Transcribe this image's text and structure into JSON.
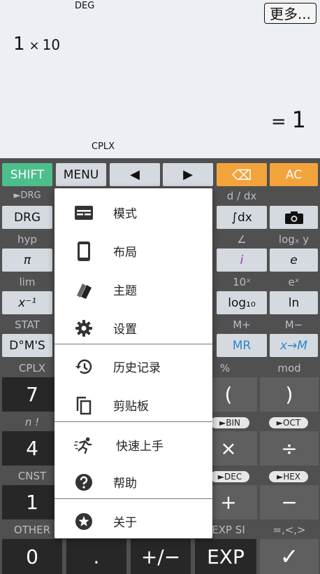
{
  "display": {
    "angle_mode": "DEG",
    "more_button": "更多...",
    "expr_mantissa": "1",
    "expr_times": "×",
    "expr_base": "10",
    "result_eq": "=",
    "result_value": "1",
    "complex_mode": "CPLX"
  },
  "top_row": {
    "shift": "SHIFT",
    "menu": "MENU",
    "left_arrow": "◀",
    "right_arrow": "▶",
    "backspace": "⌫",
    "ac": "AC"
  },
  "labels": {
    "to_drg": "►DRG",
    "ddx": "d / dx",
    "hyp": "hyp",
    "angle": "∠",
    "logxy": "logₓ y",
    "lim": "lim",
    "tenx": "10ˣ",
    "ex": "eˣ",
    "stat": "STAT",
    "mplus": "M+",
    "mminus": "M−",
    "cplx": "CPLX",
    "percent": "%",
    "mod": "mod",
    "nfact": "n !",
    "cnst": "CNST",
    "other": "OTHER",
    "expsi": "EXP SI",
    "relations": "=,<,>"
  },
  "pills": {
    "bin": "►BIN",
    "oct": "►OCT",
    "dec": "►DEC",
    "hex": "►HEX"
  },
  "keys": {
    "drg": "DRG",
    "integral": "∫dx",
    "pi": "π",
    "i": "i",
    "e": "e",
    "xinv": "x⁻¹",
    "log10": "log₁₀",
    "ln": "ln",
    "dms": "D°M'S",
    "mr": "MR",
    "xtom": "x→M",
    "seven": "7",
    "open_paren": "(",
    "close_paren": ")",
    "four": "4",
    "times": "×",
    "divide": "÷",
    "one": "1",
    "plus": "+",
    "minus": "−",
    "zero": "0",
    "dot": ".",
    "plusminus": "+/−",
    "exp": "EXP",
    "enter": "✓"
  },
  "menu": {
    "items": [
      {
        "label": "模式",
        "icon": "mode-icon"
      },
      {
        "label": "布局",
        "icon": "layout-icon"
      },
      {
        "label": "主题",
        "icon": "theme-icon"
      },
      {
        "label": "设置",
        "icon": "gear-icon"
      },
      {
        "label": "历史记录",
        "icon": "history-icon"
      },
      {
        "label": "剪贴板",
        "icon": "clipboard-icon"
      },
      {
        "label": "快速上手",
        "icon": "quick-start-icon"
      },
      {
        "label": "帮助",
        "icon": "help-icon"
      },
      {
        "label": "关于",
        "icon": "about-icon"
      }
    ]
  },
  "colors": {
    "shift": "#4cbf8c",
    "accent_orange": "#f3a33b",
    "mr_blue": "#2f86c8",
    "i_purple": "#8a3ea8"
  }
}
